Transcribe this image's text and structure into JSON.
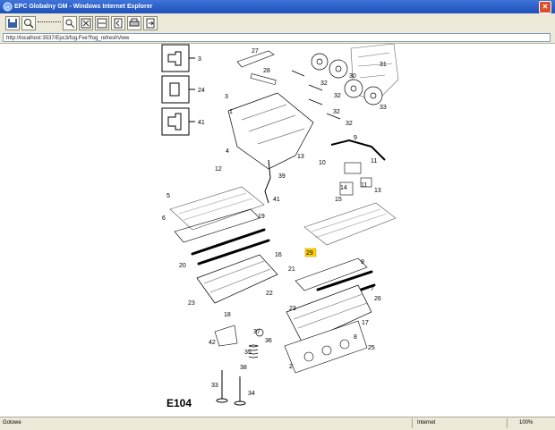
{
  "window": {
    "title": "EPC Globalny GM - Windows Internet Explorer"
  },
  "address": {
    "url": "http://localhost:3537/Epc3/fog.Fve?fog_refreshView"
  },
  "toolbar": {
    "icons": [
      "save-icon",
      "zoom-in-icon",
      "zoom-slider-icon",
      "fit-page-icon",
      "fit-width-icon",
      "prev-page-icon",
      "print-icon",
      "export-icon"
    ]
  },
  "diagram": {
    "code": "E104",
    "bolts": [
      {
        "label": "3"
      },
      {
        "label": "24"
      },
      {
        "label": "41"
      }
    ],
    "callouts": [
      "27",
      "28",
      "31",
      "30",
      "32",
      "32",
      "32",
      "32",
      "33",
      "3",
      "1",
      "9",
      "4",
      "13",
      "12",
      "39",
      "10",
      "11",
      "11",
      "14",
      "13",
      "15",
      "5",
      "6",
      "41",
      "19",
      "20",
      "29",
      "21",
      "16",
      "9",
      "7",
      "23",
      "22",
      "18",
      "17",
      "26",
      "37",
      "42",
      "36",
      "35",
      "38",
      "33",
      "34",
      "23",
      "8",
      "25",
      "2"
    ]
  },
  "status": {
    "text": "Gotowe",
    "zone": "Internet",
    "zoom": "100%"
  }
}
